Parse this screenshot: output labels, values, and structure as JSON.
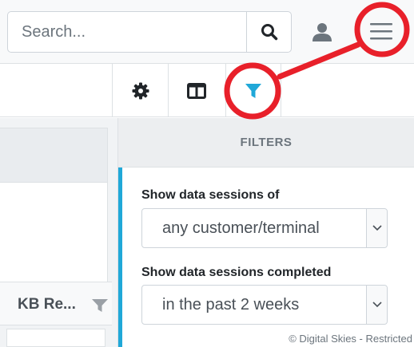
{
  "search": {
    "placeholder": "Search..."
  },
  "header": {
    "search_button_icon": "search-icon",
    "user_icon": "user-icon",
    "menu_icon": "hamburger-menu-icon"
  },
  "toolbar": {
    "settings_icon": "gear-icon",
    "columns_icon": "columns-icon",
    "filter_icon": "filter-icon"
  },
  "grid": {
    "column_header": "KB Re..."
  },
  "filters": {
    "title": "FILTERS",
    "sessions_of_label": "Show data sessions of",
    "sessions_of_value": "any customer/terminal",
    "completed_label": "Show data sessions completed",
    "completed_value": "in the past 2 weeks"
  },
  "footer": {
    "note": "© Digital Skies - Restricted"
  },
  "colors": {
    "accent": "#20a8d8",
    "annotation": "#e8202a"
  }
}
